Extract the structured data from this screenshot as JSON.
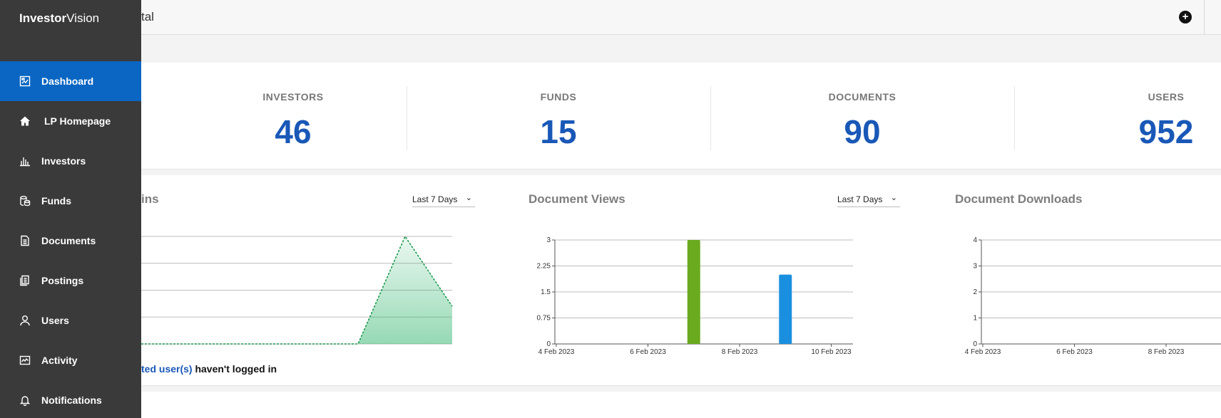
{
  "brand": {
    "bold": "Investor",
    "rest": "Vision"
  },
  "header": {
    "title_fragment": "tal"
  },
  "sidebar": {
    "items": [
      {
        "label": "Dashboard",
        "icon": "dashboard-icon",
        "active": true
      },
      {
        "label": "LP Homepage",
        "icon": "home-icon"
      },
      {
        "label": "Investors",
        "icon": "bar-chart-icon"
      },
      {
        "label": "Funds",
        "icon": "coins-icon"
      },
      {
        "label": "Documents",
        "icon": "document-icon"
      },
      {
        "label": "Postings",
        "icon": "postings-icon"
      },
      {
        "label": "Users",
        "icon": "user-icon"
      },
      {
        "label": "Activity",
        "icon": "activity-icon"
      },
      {
        "label": "Notifications",
        "icon": "bell-icon"
      }
    ]
  },
  "stats": [
    {
      "label": "INVESTORS",
      "value": "46"
    },
    {
      "label": "FUNDS",
      "value": "15"
    },
    {
      "label": "DOCUMENTS",
      "value": "90"
    },
    {
      "label": "USERS",
      "value": "952"
    }
  ],
  "logins": {
    "title_fragment": "ins",
    "range": "Last 7 Days",
    "note_link": "ted user(s)",
    "note_rest": " haven't logged in"
  },
  "colors": {
    "accent": "#0a66c2",
    "value_blue": "#1958b7",
    "green_bar": "#6aaa1f",
    "blue_bar": "#1a8fe0",
    "area_green": "#2db36b"
  },
  "chart_data": [
    {
      "type": "area",
      "title": "",
      "values": [
        0,
        0,
        0,
        0,
        0,
        0,
        4,
        1.4
      ],
      "ylim": [
        0,
        4
      ],
      "grid": true
    },
    {
      "type": "bar",
      "title": "Document Views",
      "range": "Last 7 Days",
      "x_ticks": [
        "4 Feb 2023",
        "6 Feb 2023",
        "8 Feb 2023",
        "10 Feb 2023"
      ],
      "y_ticks": [
        "0",
        "0.75",
        "1.5",
        "2.25",
        "3"
      ],
      "ylim": [
        0,
        3
      ],
      "bars": [
        {
          "day": 7,
          "value": 3,
          "color": "#6aaa1f"
        },
        {
          "day": 9,
          "value": 2,
          "color": "#1a8fe0"
        }
      ],
      "grid": true
    },
    {
      "type": "bar",
      "title": "Document Downloads",
      "x_ticks": [
        "4 Feb 2023",
        "6 Feb 2023",
        "8 Feb 2023"
      ],
      "y_ticks": [
        "0",
        "1",
        "2",
        "3",
        "4"
      ],
      "ylim": [
        0,
        4
      ],
      "bars": [],
      "grid": true
    }
  ]
}
